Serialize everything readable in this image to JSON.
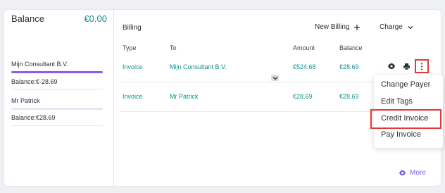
{
  "balance": {
    "title": "Balance",
    "amount": "€0.00"
  },
  "payers": [
    {
      "name": "Mijn Consultant B.V.",
      "balance": "Balance:€-28.69",
      "bar_fill": 1.0,
      "bar_color": "#8b5cf6"
    },
    {
      "name": "Mr Patrick",
      "balance": "Balance:€28.69",
      "bar_fill": 0.0,
      "bar_color": "#8b5cf6"
    }
  ],
  "billing": {
    "title": "Billing",
    "new_billing_label": "New Billing",
    "charge_label": "Charge",
    "columns": {
      "type": "Type",
      "to": "To",
      "amount": "Amount",
      "balance": "Balance"
    },
    "rows": [
      {
        "type": "Invoice",
        "to": "Mijn Consultant B.V.",
        "amount": "€524.68",
        "balance": "€28.69"
      },
      {
        "type": "Invoice",
        "to": "Mr Patrick",
        "amount": "€28.69",
        "balance": "€28.69"
      }
    ]
  },
  "menu": {
    "items": [
      "Change Payer",
      "Edit Tags",
      "Credit Invoice",
      "Pay Invoice"
    ]
  },
  "more_label": "More",
  "colors": {
    "accent": "#0d9488",
    "purple": "#7c5cf2",
    "highlight": "#e53935"
  }
}
